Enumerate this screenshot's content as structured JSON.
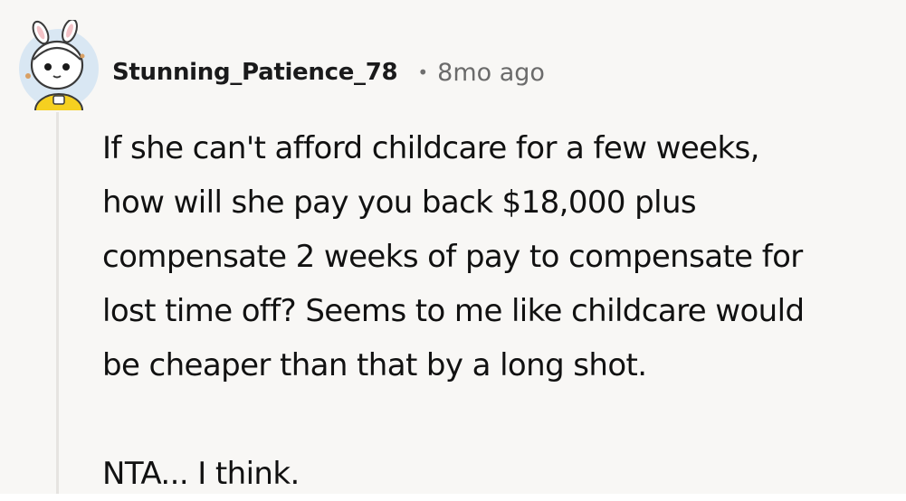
{
  "comment": {
    "username": "Stunning_Patience_78",
    "separator": "•",
    "timestamp": "8mo ago",
    "avatar_icon": "snoo-bunny-hood-avatar-icon",
    "body_lines": [
      "If she can't afford childcare for a few weeks,",
      "how will she pay you back $18,000 plus",
      "compensate 2 weeks of pay to compensate for",
      "lost time off? Seems to me like childcare would",
      "be cheaper than that by a long shot."
    ],
    "closing": "NTA... I think."
  },
  "colors": {
    "background": "#f8f7f5",
    "text": "#111111",
    "muted": "#6b6b6b",
    "thread_line": "#e6e4e1",
    "avatar_bg": "#d9e7f3",
    "avatar_shirt": "#f5d020"
  }
}
